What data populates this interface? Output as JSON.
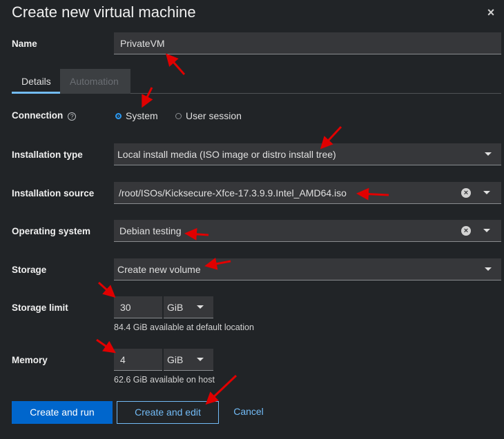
{
  "dialog": {
    "title": "Create new virtual machine",
    "close_glyph": "×"
  },
  "name": {
    "label": "Name",
    "value": "PrivateVM"
  },
  "tabs": [
    {
      "label": "Details",
      "active": true
    },
    {
      "label": "Automation",
      "active": false
    }
  ],
  "connection": {
    "label": "Connection",
    "help_glyph": "?",
    "options": [
      {
        "label": "System",
        "checked": true
      },
      {
        "label": "User session",
        "checked": false
      }
    ]
  },
  "installation_type": {
    "label": "Installation type",
    "value": "Local install media (ISO image or distro install tree)"
  },
  "installation_source": {
    "label": "Installation source",
    "value": "/root/ISOs/Kicksecure-Xfce-17.3.9.9.Intel_AMD64.iso"
  },
  "operating_system": {
    "label": "Operating system",
    "value": "Debian testing"
  },
  "storage": {
    "label": "Storage",
    "value": "Create new volume"
  },
  "storage_limit": {
    "label": "Storage limit",
    "value": "30",
    "unit": "GiB",
    "helper": "84.4 GiB available at default location"
  },
  "memory": {
    "label": "Memory",
    "value": "4",
    "unit": "GiB",
    "helper": "62.6 GiB available on host"
  },
  "footer": {
    "create_run": "Create and run",
    "create_edit": "Create and edit",
    "cancel": "Cancel"
  },
  "colors": {
    "primary": "#0066cc",
    "link": "#73bcf7",
    "annotation_arrow": "#e00000"
  }
}
